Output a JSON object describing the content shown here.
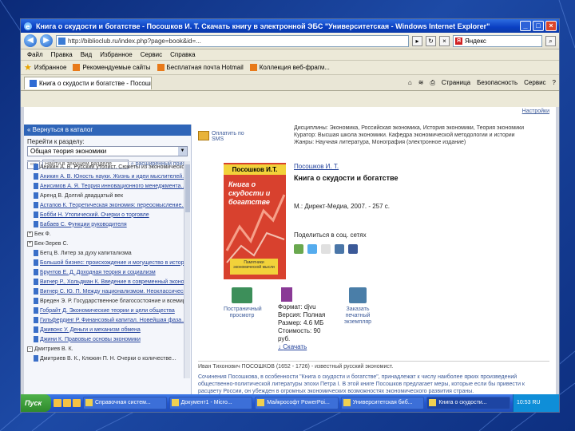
{
  "window": {
    "title": "Книга о скудости и богатстве - Посошков И. Т. Скачать книгу в электронной ЭБС \"Университетская - Windows Internet Explorer\""
  },
  "address": {
    "url": "http://biblioclub.ru/index.php?page=book&id=..."
  },
  "search": {
    "value": "Яндекс"
  },
  "menu": [
    "Файл",
    "Правка",
    "Вид",
    "Избранное",
    "Сервис",
    "Справка"
  ],
  "favorites": {
    "label": "Избранное",
    "items": [
      "Рекомендуемые сайты",
      "Бесплатная почта Hotmail",
      "Коллекция веб-фрагм..."
    ]
  },
  "tab": {
    "label": "Книга о скудости и богатстве - Посошков И. Т. Скач...",
    "tools": [
      "Страница",
      "Безопасность",
      "Сервис"
    ]
  },
  "page": {
    "top_link": "Настройки",
    "back": "« Вернуться в каталог",
    "goto_label": "Перейти к разделу:",
    "section_select": "Общая теория экономики",
    "search_placeholder": "Найти в текущем разделе",
    "advanced_search": "расширенный поиск",
    "tree": [
      {
        "lvl": 1,
        "text": "Аникин А. В. Русский утопист. Сюжеты из экономической..."
      },
      {
        "lvl": 1,
        "text": "Аникин А. В. Юность науки. Жизнь и идеи мыслителей...",
        "link": true
      },
      {
        "lvl": 1,
        "text": "Анисимов А. Я. Теория инновационного менеджмента...",
        "link": true
      },
      {
        "lvl": 1,
        "text": "Аренд В. Долгий двадцатый век"
      },
      {
        "lvl": 1,
        "text": "Астапов К. Теоретическая экономия: переосмысление...",
        "link": true
      },
      {
        "lvl": 1,
        "text": "Бобби Н. Утопический. Очерки о торговле",
        "link": true
      },
      {
        "lvl": 1,
        "text": "Бабаев С. Функции руководителя",
        "link": true
      },
      {
        "lvl": 0,
        "text": "Бек Ф.",
        "pm": "+"
      },
      {
        "lvl": 0,
        "text": "Бек-Зерев С.",
        "pm": "+"
      },
      {
        "lvl": 1,
        "text": "Бетц В. Литер за духу капитализма"
      },
      {
        "lvl": 1,
        "text": "Большой бизнес: происхождение и могущество в истории",
        "link": true
      },
      {
        "lvl": 1,
        "text": "Брунтов Е. Д. Доходная теория и социализм",
        "link": true
      },
      {
        "lvl": 1,
        "text": "Вигнер Р., Хольдман К. Введение в современный экономический...",
        "link": true
      },
      {
        "lvl": 1,
        "text": "Вигнер С. Ю. П. Между национализмом. Неоклассический...",
        "link": true
      },
      {
        "lvl": 1,
        "text": "Вреден Э. Р. Государственное благосостояние и всемирная..."
      },
      {
        "lvl": 1,
        "text": "Гобрайт Д. Экономические теории и цели общества",
        "link": true
      },
      {
        "lvl": 1,
        "text": "Гильфердинг Р. Финансовый капитал. Новейшая фаза...",
        "link": true
      },
      {
        "lvl": 1,
        "text": "Дживонс У. Деньги и механизм обмена",
        "link": true
      },
      {
        "lvl": 1,
        "text": "Джини К. Правовые основы экономики",
        "link": true
      },
      {
        "lvl": 0,
        "text": "Дмитриев В. К.",
        "pm": "-"
      },
      {
        "lvl": 1,
        "text": "Дмитриев В. К., Клюкин П. Н. Очерки о количестве..."
      }
    ],
    "pay": "Оплатить по SMS",
    "meta": [
      "Дисциплины: Экономика, Российская экономика, История экономики, Теория экономики",
      "Куратор: Высшая школа экономики. Кафедра экономической методологии и истории",
      "Жанры: Научная литература, Монография (электронное издание)"
    ],
    "cover": {
      "author": "Посошков И.Т.",
      "title": "Книга о скудости и богатстве",
      "label": "Памятники экономической мысли"
    },
    "book_author": "Посошков И. Т.",
    "book_title": "Книга о скудости и богатстве",
    "publisher": "М.: Директ-Медиа, 2007. - 257 с.",
    "share": "Поделиться в соц. сетях",
    "page_view": "Постраничный просмотр",
    "format": {
      "format": "Формат: djvu",
      "version": "Версия: Полная",
      "size": "Размер: 4.6 МБ",
      "price": "Стоимость: 90 руб.",
      "download": "Скачать"
    },
    "order": "Заказать печатный экземпляр",
    "about_header": "Иван Тихонович ПОСОШКОВ (1652 - 1726) - известный русский экономист.",
    "about_text": "Сочинения Посошкова, в особенности \"Книга о скудости и богатстве\", принадлежат к числу наиболее ярких произведений общественно-политической литературы эпохи Петра I. В этой книге Посошков предлагает меры, которые если бы привести к расцвету России, он убежден в огромных экономических возможностях экономического развития страны."
  },
  "taskbar": {
    "start": "Пуск",
    "tasks": [
      "Справочная систем...",
      "Документ1 - Micro...",
      "Майкрософт PowerPoi...",
      "Университетская биб...",
      "Книга о скудости..."
    ],
    "active_index": 4,
    "tray": "10:53 RU"
  },
  "colors": {
    "accent": "#2f65b8",
    "cover": "#d8412e",
    "cover_band": "#f2d23a"
  }
}
